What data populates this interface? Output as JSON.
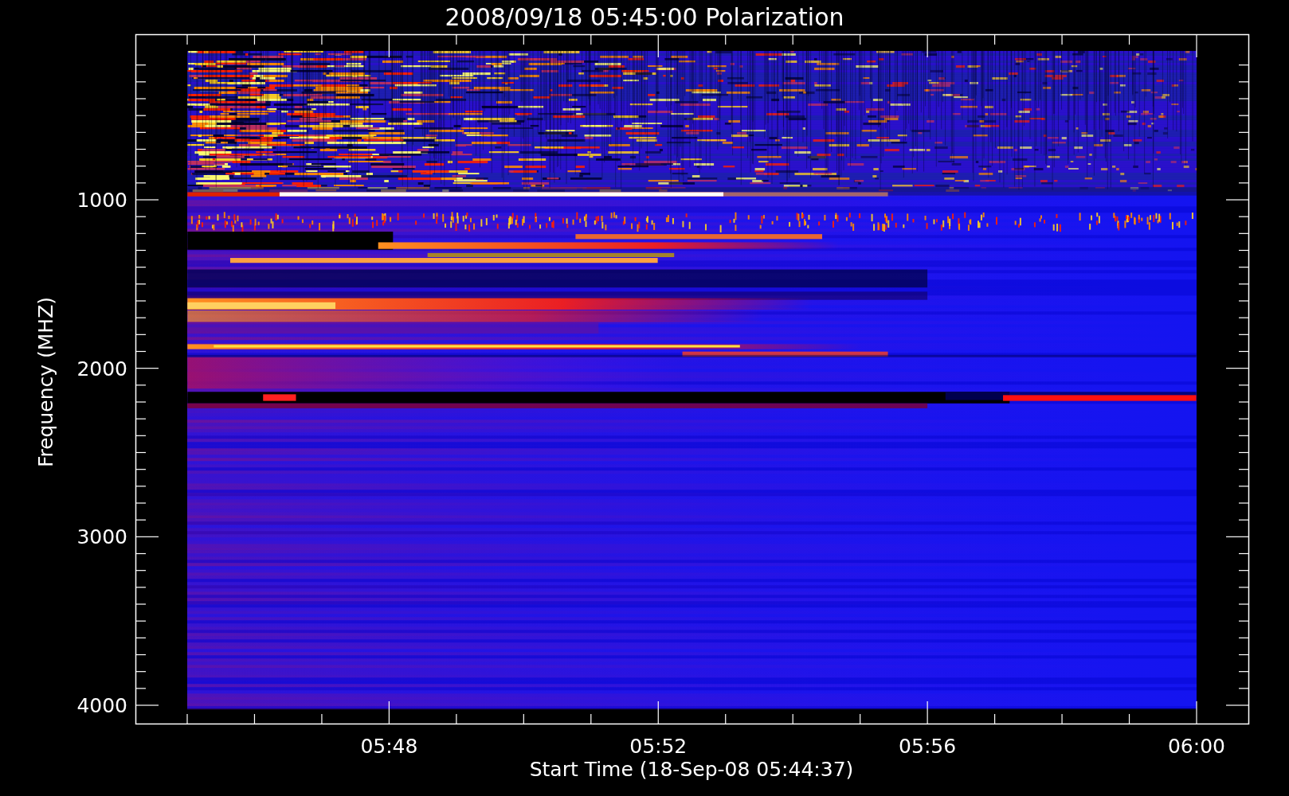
{
  "title": "2008/09/18 05:45:00 Polarization",
  "spectrogram": {
    "ylabel": "Frequency (MHZ)",
    "xlabel": "Start Time (18-Sep-08 05:44:37)",
    "yticks": [
      "1000",
      "2000",
      "3000",
      "4000"
    ],
    "xticks": [
      "05:48",
      "05:52",
      "05:56",
      "06:00"
    ]
  }
}
